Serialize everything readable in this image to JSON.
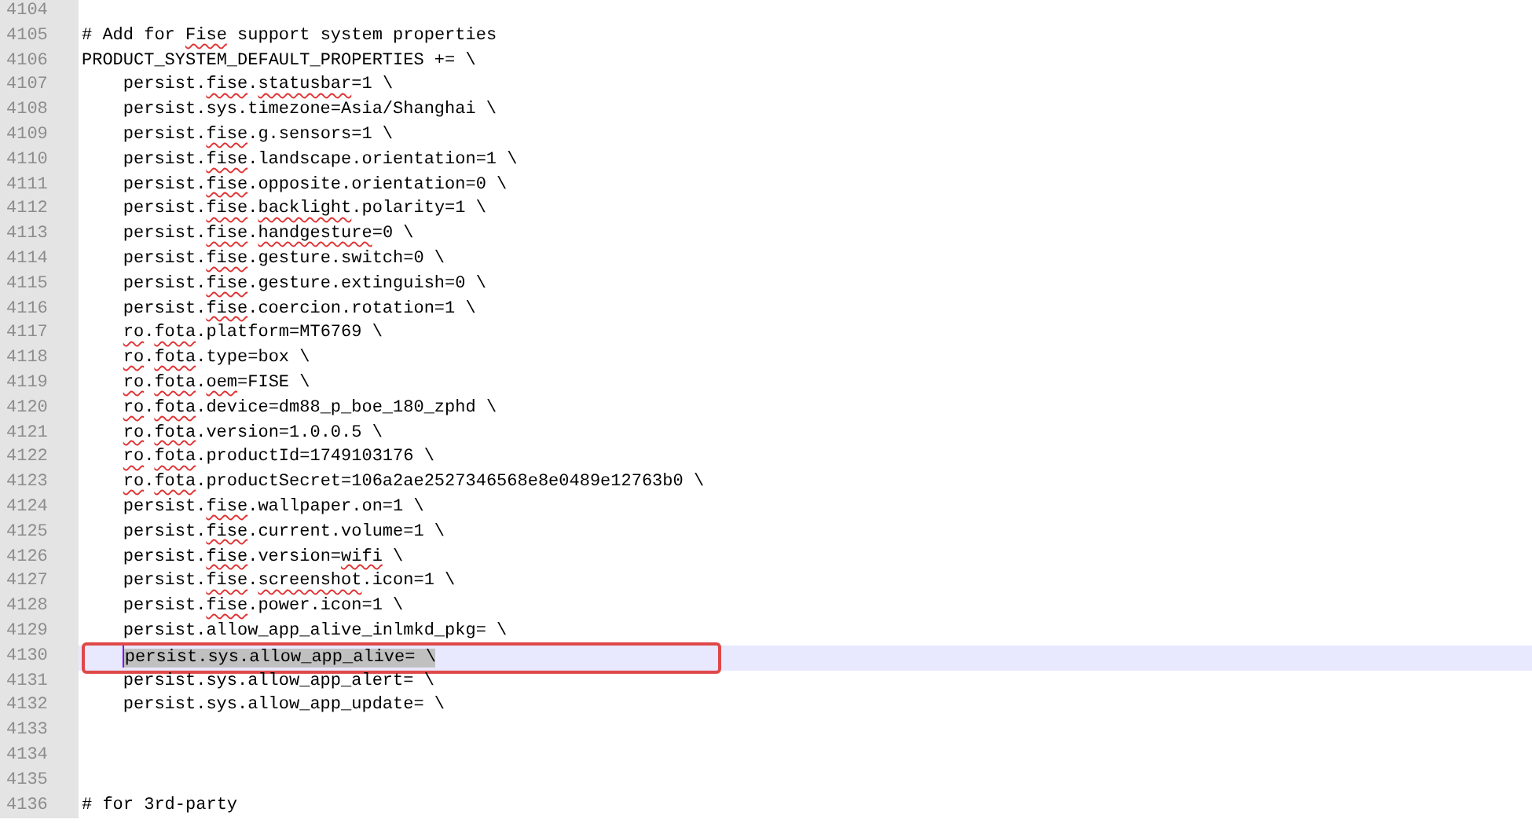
{
  "editor": {
    "lines": [
      {
        "number": "4104",
        "current": false
      },
      {
        "number": "4105",
        "current": false,
        "indented": false,
        "segments": [
          {
            "text": "# Add for ",
            "misspelled": false,
            "selected": false
          },
          {
            "text": "Fise",
            "misspelled": true,
            "selected": false
          },
          {
            "text": " support system properties",
            "misspelled": false,
            "selected": false
          }
        ]
      },
      {
        "number": "4106",
        "current": false,
        "indented": false,
        "segments": [
          {
            "text": "PRODUCT_SYSTEM_DEFAULT_PROPERTIES += \\",
            "misspelled": false,
            "selected": false
          }
        ]
      },
      {
        "number": "4107",
        "current": false,
        "indented": true,
        "segments": [
          {
            "text": "persist.",
            "misspelled": false,
            "selected": false
          },
          {
            "text": "fise",
            "misspelled": true,
            "selected": false
          },
          {
            "text": ".",
            "misspelled": false,
            "selected": false
          },
          {
            "text": "statusbar",
            "misspelled": true,
            "selected": false
          },
          {
            "text": "=1 \\",
            "misspelled": false,
            "selected": false
          }
        ]
      },
      {
        "number": "4108",
        "current": false,
        "indented": true,
        "segments": [
          {
            "text": "persist.sys.timezone=Asia/Shanghai \\",
            "misspelled": false,
            "selected": false
          }
        ]
      },
      {
        "number": "4109",
        "current": false,
        "indented": true,
        "segments": [
          {
            "text": "persist.",
            "misspelled": false,
            "selected": false
          },
          {
            "text": "fise",
            "misspelled": true,
            "selected": false
          },
          {
            "text": ".g.sensors=1 \\",
            "misspelled": false,
            "selected": false
          }
        ]
      },
      {
        "number": "4110",
        "current": false,
        "indented": true,
        "segments": [
          {
            "text": "persist.",
            "misspelled": false,
            "selected": false
          },
          {
            "text": "fise",
            "misspelled": true,
            "selected": false
          },
          {
            "text": ".landscape.orientation=1 \\",
            "misspelled": false,
            "selected": false
          }
        ]
      },
      {
        "number": "4111",
        "current": false,
        "indented": true,
        "segments": [
          {
            "text": "persist.",
            "misspelled": false,
            "selected": false
          },
          {
            "text": "fise",
            "misspelled": true,
            "selected": false
          },
          {
            "text": ".opposite.orientation=0 \\",
            "misspelled": false,
            "selected": false
          }
        ]
      },
      {
        "number": "4112",
        "current": false,
        "indented": true,
        "segments": [
          {
            "text": "persist.",
            "misspelled": false,
            "selected": false
          },
          {
            "text": "fise",
            "misspelled": true,
            "selected": false
          },
          {
            "text": ".",
            "misspelled": false,
            "selected": false
          },
          {
            "text": "backlight",
            "misspelled": true,
            "selected": false
          },
          {
            "text": ".polarity=1 \\",
            "misspelled": false,
            "selected": false
          }
        ]
      },
      {
        "number": "4113",
        "current": false,
        "indented": true,
        "segments": [
          {
            "text": "persist.",
            "misspelled": false,
            "selected": false
          },
          {
            "text": "fise",
            "misspelled": true,
            "selected": false
          },
          {
            "text": ".",
            "misspelled": false,
            "selected": false
          },
          {
            "text": "handgesture",
            "misspelled": true,
            "selected": false
          },
          {
            "text": "=0 \\",
            "misspelled": false,
            "selected": false
          }
        ]
      },
      {
        "number": "4114",
        "current": false,
        "indented": true,
        "segments": [
          {
            "text": "persist.",
            "misspelled": false,
            "selected": false
          },
          {
            "text": "fise",
            "misspelled": true,
            "selected": false
          },
          {
            "text": ".gesture.switch=0 \\",
            "misspelled": false,
            "selected": false
          }
        ]
      },
      {
        "number": "4115",
        "current": false,
        "indented": true,
        "segments": [
          {
            "text": "persist.",
            "misspelled": false,
            "selected": false
          },
          {
            "text": "fise",
            "misspelled": true,
            "selected": false
          },
          {
            "text": ".gesture.extinguish=0 \\",
            "misspelled": false,
            "selected": false
          }
        ]
      },
      {
        "number": "4116",
        "current": false,
        "indented": true,
        "segments": [
          {
            "text": "persist.",
            "misspelled": false,
            "selected": false
          },
          {
            "text": "fise",
            "misspelled": true,
            "selected": false
          },
          {
            "text": ".coercion.rotation=1 \\",
            "misspelled": false,
            "selected": false
          }
        ]
      },
      {
        "number": "4117",
        "current": false,
        "indented": true,
        "segments": [
          {
            "text": "ro",
            "misspelled": true,
            "selected": false
          },
          {
            "text": ".",
            "misspelled": false,
            "selected": false
          },
          {
            "text": "fota",
            "misspelled": true,
            "selected": false
          },
          {
            "text": ".platform=MT6769 \\",
            "misspelled": false,
            "selected": false
          }
        ]
      },
      {
        "number": "4118",
        "current": false,
        "indented": true,
        "segments": [
          {
            "text": "ro",
            "misspelled": true,
            "selected": false
          },
          {
            "text": ".",
            "misspelled": false,
            "selected": false
          },
          {
            "text": "fota",
            "misspelled": true,
            "selected": false
          },
          {
            "text": ".type=box \\",
            "misspelled": false,
            "selected": false
          }
        ]
      },
      {
        "number": "4119",
        "current": false,
        "indented": true,
        "segments": [
          {
            "text": "ro",
            "misspelled": true,
            "selected": false
          },
          {
            "text": ".",
            "misspelled": false,
            "selected": false
          },
          {
            "text": "fota",
            "misspelled": true,
            "selected": false
          },
          {
            "text": ".",
            "misspelled": false,
            "selected": false
          },
          {
            "text": "oem",
            "misspelled": true,
            "selected": false
          },
          {
            "text": "=FISE \\",
            "misspelled": false,
            "selected": false
          }
        ]
      },
      {
        "number": "4120",
        "current": false,
        "indented": true,
        "segments": [
          {
            "text": "ro",
            "misspelled": true,
            "selected": false
          },
          {
            "text": ".",
            "misspelled": false,
            "selected": false
          },
          {
            "text": "fota",
            "misspelled": true,
            "selected": false
          },
          {
            "text": ".device=dm88_p_boe_180_zphd \\",
            "misspelled": false,
            "selected": false
          }
        ]
      },
      {
        "number": "4121",
        "current": false,
        "indented": true,
        "segments": [
          {
            "text": "ro",
            "misspelled": true,
            "selected": false
          },
          {
            "text": ".",
            "misspelled": false,
            "selected": false
          },
          {
            "text": "fota",
            "misspelled": true,
            "selected": false
          },
          {
            "text": ".version=1.0.0.5 \\",
            "misspelled": false,
            "selected": false
          }
        ]
      },
      {
        "number": "4122",
        "current": false,
        "indented": true,
        "segments": [
          {
            "text": "ro",
            "misspelled": true,
            "selected": false
          },
          {
            "text": ".",
            "misspelled": false,
            "selected": false
          },
          {
            "text": "fota",
            "misspelled": true,
            "selected": false
          },
          {
            "text": ".productId=1749103176 \\",
            "misspelled": false,
            "selected": false
          }
        ]
      },
      {
        "number": "4123",
        "current": false,
        "indented": true,
        "segments": [
          {
            "text": "ro",
            "misspelled": true,
            "selected": false
          },
          {
            "text": ".",
            "misspelled": false,
            "selected": false
          },
          {
            "text": "fota",
            "misspelled": true,
            "selected": false
          },
          {
            "text": ".productSecret=106a2ae2527346568e8e0489e12763b0 \\",
            "misspelled": false,
            "selected": false
          }
        ]
      },
      {
        "number": "4124",
        "current": false,
        "indented": true,
        "segments": [
          {
            "text": "persist.",
            "misspelled": false,
            "selected": false
          },
          {
            "text": "fise",
            "misspelled": true,
            "selected": false
          },
          {
            "text": ".wallpaper.on=1 \\",
            "misspelled": false,
            "selected": false
          }
        ]
      },
      {
        "number": "4125",
        "current": false,
        "indented": true,
        "segments": [
          {
            "text": "persist.",
            "misspelled": false,
            "selected": false
          },
          {
            "text": "fise",
            "misspelled": true,
            "selected": false
          },
          {
            "text": ".current.volume=1 \\",
            "misspelled": false,
            "selected": false
          }
        ]
      },
      {
        "number": "4126",
        "current": false,
        "indented": true,
        "segments": [
          {
            "text": "persist.",
            "misspelled": false,
            "selected": false
          },
          {
            "text": "fise",
            "misspelled": true,
            "selected": false
          },
          {
            "text": ".version=",
            "misspelled": false,
            "selected": false
          },
          {
            "text": "wifi",
            "misspelled": true,
            "selected": false
          },
          {
            "text": " \\",
            "misspelled": false,
            "selected": false
          }
        ]
      },
      {
        "number": "4127",
        "current": false,
        "indented": true,
        "segments": [
          {
            "text": "persist.",
            "misspelled": false,
            "selected": false
          },
          {
            "text": "fise",
            "misspelled": true,
            "selected": false
          },
          {
            "text": ".",
            "misspelled": false,
            "selected": false
          },
          {
            "text": "screenshot",
            "misspelled": true,
            "selected": false
          },
          {
            "text": ".icon=1 \\",
            "misspelled": false,
            "selected": false
          }
        ]
      },
      {
        "number": "4128",
        "current": false,
        "indented": true,
        "segments": [
          {
            "text": "persist.",
            "misspelled": false,
            "selected": false
          },
          {
            "text": "fise",
            "misspelled": true,
            "selected": false
          },
          {
            "text": ".power.icon=1 \\",
            "misspelled": false,
            "selected": false
          }
        ]
      },
      {
        "number": "4129",
        "current": false,
        "indented": true,
        "segments": [
          {
            "text": "persist.allow_app_alive_inlmkd_pkg= \\",
            "misspelled": false,
            "selected": false
          }
        ]
      },
      {
        "number": "4130",
        "current": true,
        "indented": true,
        "segments": [
          {
            "text": "persist.sys.allow_app_alive= \\",
            "misspelled": false,
            "selected": true
          }
        ]
      },
      {
        "number": "4131",
        "current": false,
        "indented": true,
        "segments": [
          {
            "text": "persist.sys.allow_app_alert= \\",
            "misspelled": false,
            "selected": false
          }
        ]
      },
      {
        "number": "4132",
        "current": false,
        "indented": true,
        "segments": [
          {
            "text": "persist.sys.allow_app_update= \\",
            "misspelled": false,
            "selected": false
          }
        ]
      },
      {
        "number": "4133",
        "current": false
      },
      {
        "number": "4134",
        "current": false
      },
      {
        "number": "4135",
        "current": false
      },
      {
        "number": "4136",
        "current": false,
        "indented": false,
        "segments": [
          {
            "text": "# for 3rd-party",
            "misspelled": false,
            "selected": false
          }
        ]
      }
    ]
  }
}
